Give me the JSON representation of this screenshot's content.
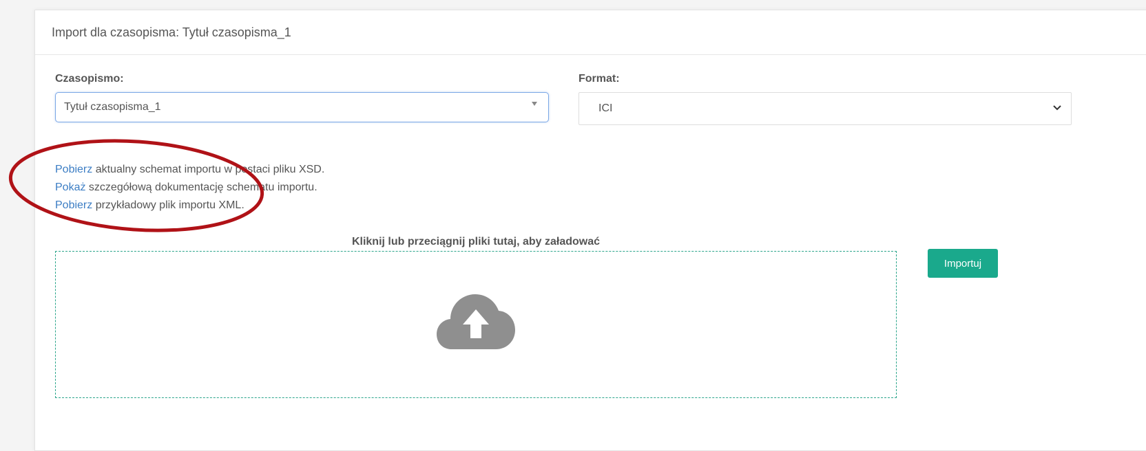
{
  "header": {
    "title": "Import dla czasopisma: Tytuł czasopisma_1"
  },
  "journal": {
    "label": "Czasopismo:",
    "selected": "Tytuł czasopisma_1"
  },
  "format": {
    "label": "Format:",
    "selected": "ICI"
  },
  "links": [
    {
      "link_text": "Pobierz",
      "rest": " aktualny schemat importu w postaci pliku XSD."
    },
    {
      "link_text": "Pokaż",
      "rest": " szczegółową dokumentację schematu importu."
    },
    {
      "link_text": "Pobierz",
      "rest": " przykładowy plik importu XML."
    }
  ],
  "dropzone": {
    "title": "Kliknij lub przeciągnij pliki tutaj, aby załadować",
    "icon": "cloud-upload-icon"
  },
  "import_button": {
    "label": "Importuj"
  },
  "colors": {
    "link": "#3b7dc4",
    "accent": "#1aa98c",
    "dropzone_border": "#2aa58a",
    "annotation": "#b01217",
    "cloud_icon": "#8f8f8f"
  }
}
